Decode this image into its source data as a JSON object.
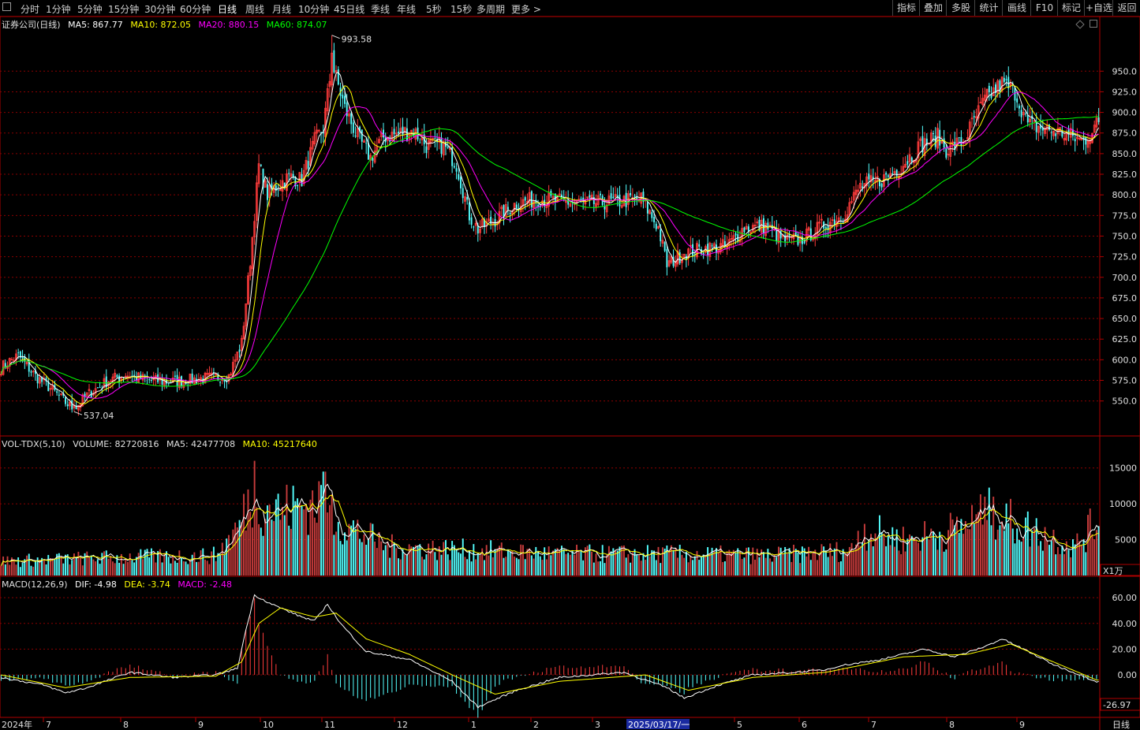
{
  "toolbar": {
    "periods": [
      "分时",
      "1分钟",
      "5分钟",
      "15分钟",
      "30分钟",
      "60分钟",
      "日线",
      "周线",
      "月线",
      "10分钟",
      "45日线",
      "季线",
      "年线",
      "5秒",
      "15秒",
      "多周期",
      "更多 >"
    ],
    "active": "日线",
    "right_buttons": [
      "指标",
      "叠加",
      "多股",
      "统计",
      "画线",
      "F10",
      "标记",
      "+自选",
      "返回"
    ]
  },
  "price_panel": {
    "title": "证券公司(日线)",
    "ma5": "MA5: 867.77",
    "ma10": "MA10: 872.05",
    "ma20": "MA20: 880.15",
    "ma60": "MA60: 874.07",
    "high_label": "993.58",
    "low_label": "537.04"
  },
  "volume_panel": {
    "title": "VOL-TDX(5,10)",
    "volume": "VOLUME: 82720816",
    "ma5": "MA5: 42477708",
    "ma10": "MA10: 45217640",
    "unit": "X1万"
  },
  "macd_panel": {
    "title": "MACD(12,26,9)",
    "dif": "DIF: -4.98",
    "dea": "DEA: -3.74",
    "macd": "MACD: -2.48",
    "current": "-26.97"
  },
  "x_axis": {
    "labels": [
      "2024年",
      "7",
      "8",
      "9",
      "10",
      "11",
      "12",
      "1",
      "2",
      "3",
      "2025/03/17/一",
      "5",
      "6",
      "7",
      "8",
      "9"
    ],
    "period": "日线"
  },
  "colors": {
    "up": "#ff3c3c",
    "down": "#54ffff",
    "ma5": "#ffffff",
    "ma10": "#ffff00",
    "ma20": "#ff00ff",
    "ma60": "#00ff00",
    "grid": "#8b0000",
    "axis": "#b00000"
  },
  "chart_data": [
    {
      "type": "candlestick",
      "title": "证券公司(日线)",
      "y_ticks": [
        550,
        575,
        600,
        625,
        650,
        675,
        700,
        725,
        750,
        775,
        800,
        825,
        850,
        875,
        900,
        925,
        950
      ],
      "ylim": [
        520,
        1000
      ],
      "anchors": [
        [
          0,
          590
        ],
        [
          2,
          595
        ],
        [
          8,
          605
        ],
        [
          16,
          580
        ],
        [
          24,
          563
        ],
        [
          30,
          548
        ],
        [
          34,
          540
        ],
        [
          40,
          557
        ],
        [
          50,
          575
        ],
        [
          58,
          582
        ],
        [
          66,
          577
        ],
        [
          76,
          573
        ],
        [
          86,
          575
        ],
        [
          96,
          578
        ],
        [
          106,
          580
        ],
        [
          112,
          620
        ],
        [
          116,
          720
        ],
        [
          120,
          835
        ],
        [
          124,
          800
        ],
        [
          128,
          810
        ],
        [
          134,
          822
        ],
        [
          140,
          818
        ],
        [
          146,
          865
        ],
        [
          150,
          880
        ],
        [
          154,
          960
        ],
        [
          160,
          905
        ],
        [
          166,
          870
        ],
        [
          172,
          845
        ],
        [
          178,
          870
        ],
        [
          186,
          875
        ],
        [
          192,
          878
        ],
        [
          198,
          860
        ],
        [
          206,
          860
        ],
        [
          212,
          837
        ],
        [
          218,
          775
        ],
        [
          222,
          758
        ],
        [
          230,
          770
        ],
        [
          240,
          790
        ],
        [
          250,
          795
        ],
        [
          260,
          792
        ],
        [
          270,
          790
        ],
        [
          278,
          790
        ],
        [
          288,
          792
        ],
        [
          298,
          795
        ],
        [
          306,
          760
        ],
        [
          310,
          715
        ],
        [
          318,
          730
        ],
        [
          328,
          735
        ],
        [
          338,
          738
        ],
        [
          346,
          760
        ],
        [
          356,
          762
        ],
        [
          364,
          745
        ],
        [
          372,
          745
        ],
        [
          384,
          765
        ],
        [
          392,
          775
        ],
        [
          400,
          810
        ],
        [
          410,
          818
        ],
        [
          418,
          832
        ],
        [
          428,
          860
        ],
        [
          436,
          870
        ],
        [
          440,
          855
        ],
        [
          448,
          865
        ],
        [
          458,
          915
        ],
        [
          466,
          935
        ],
        [
          472,
          925
        ],
        [
          478,
          885
        ],
        [
          486,
          880
        ],
        [
          494,
          875
        ],
        [
          504,
          865
        ],
        [
          510,
          885
        ]
      ],
      "ma5_label": "MA5: 867.77",
      "ma10_label": "MA10: 872.05",
      "ma20_label": "MA20: 880.15",
      "ma60_label": "MA60: 874.07"
    },
    {
      "type": "bar",
      "title": "VOL-TDX(5,10)",
      "unit": "X1万",
      "y_ticks": [
        5000,
        10000,
        15000
      ],
      "ylim": [
        0,
        16500
      ],
      "anchors": [
        [
          0,
          2000
        ],
        [
          50,
          2500
        ],
        [
          100,
          2800
        ],
        [
          110,
          6500
        ],
        [
          118,
          12000
        ],
        [
          122,
          10000
        ],
        [
          130,
          9000
        ],
        [
          150,
          10500
        ],
        [
          160,
          7000
        ],
        [
          180,
          4000
        ],
        [
          220,
          3500
        ],
        [
          260,
          3000
        ],
        [
          310,
          3000
        ],
        [
          360,
          2800
        ],
        [
          396,
          3500
        ],
        [
          400,
          6500
        ],
        [
          420,
          5000
        ],
        [
          440,
          6000
        ],
        [
          460,
          8500
        ],
        [
          470,
          7500
        ],
        [
          500,
          4000
        ],
        [
          510,
          7500
        ]
      ]
    },
    {
      "type": "line",
      "title": "MACD(12,26,9)",
      "y_ticks": [
        0,
        20,
        40,
        60
      ],
      "ylim": [
        -30,
        65
      ],
      "dif_anchors": [
        [
          0,
          -2
        ],
        [
          20,
          -8
        ],
        [
          30,
          -14
        ],
        [
          40,
          -10
        ],
        [
          60,
          2
        ],
        [
          80,
          -2
        ],
        [
          100,
          0
        ],
        [
          110,
          5
        ],
        [
          114,
          35
        ],
        [
          118,
          62
        ],
        [
          126,
          55
        ],
        [
          140,
          45
        ],
        [
          146,
          42
        ],
        [
          152,
          55
        ],
        [
          158,
          40
        ],
        [
          170,
          18
        ],
        [
          190,
          12
        ],
        [
          210,
          -5
        ],
        [
          222,
          -25
        ],
        [
          240,
          -12
        ],
        [
          260,
          -2
        ],
        [
          290,
          2
        ],
        [
          310,
          -10
        ],
        [
          318,
          -18
        ],
        [
          334,
          -8
        ],
        [
          350,
          0
        ],
        [
          370,
          2
        ],
        [
          384,
          4
        ],
        [
          390,
          7
        ],
        [
          410,
          12
        ],
        [
          430,
          20
        ],
        [
          444,
          14
        ],
        [
          458,
          22
        ],
        [
          466,
          28
        ],
        [
          476,
          20
        ],
        [
          490,
          8
        ],
        [
          510,
          -5
        ]
      ],
      "dea_anchors": [
        [
          0,
          0
        ],
        [
          30,
          -10
        ],
        [
          60,
          -2
        ],
        [
          100,
          -1
        ],
        [
          112,
          10
        ],
        [
          120,
          40
        ],
        [
          130,
          52
        ],
        [
          146,
          45
        ],
        [
          156,
          48
        ],
        [
          170,
          28
        ],
        [
          190,
          16
        ],
        [
          210,
          0
        ],
        [
          230,
          -15
        ],
        [
          260,
          -5
        ],
        [
          300,
          0
        ],
        [
          320,
          -12
        ],
        [
          350,
          -2
        ],
        [
          384,
          2
        ],
        [
          420,
          14
        ],
        [
          450,
          16
        ],
        [
          470,
          24
        ],
        [
          490,
          10
        ],
        [
          510,
          -4
        ]
      ],
      "dif_label": "DIF: -4.98",
      "dea_label": "DEA: -3.74",
      "macd_label": "MACD: -2.48"
    }
  ]
}
